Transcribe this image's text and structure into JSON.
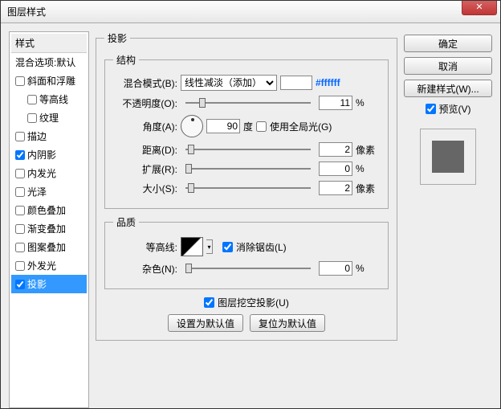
{
  "title": "图层样式",
  "left": {
    "header": "样式",
    "blend_defaults": "混合选项:默认",
    "items": [
      {
        "label": "斜面和浮雕",
        "checked": false,
        "sub": false
      },
      {
        "label": "等高线",
        "checked": false,
        "sub": true
      },
      {
        "label": "纹理",
        "checked": false,
        "sub": true
      },
      {
        "label": "描边",
        "checked": false,
        "sub": false
      },
      {
        "label": "内阴影",
        "checked": true,
        "sub": false
      },
      {
        "label": "内发光",
        "checked": false,
        "sub": false
      },
      {
        "label": "光泽",
        "checked": false,
        "sub": false
      },
      {
        "label": "颜色叠加",
        "checked": false,
        "sub": false
      },
      {
        "label": "渐变叠加",
        "checked": false,
        "sub": false
      },
      {
        "label": "图案叠加",
        "checked": false,
        "sub": false
      },
      {
        "label": "外发光",
        "checked": false,
        "sub": false
      },
      {
        "label": "投影",
        "checked": true,
        "sub": false,
        "selected": true
      }
    ]
  },
  "mid": {
    "group_title": "投影",
    "structure": "结构",
    "blend_mode_label": "混合模式(B):",
    "blend_mode_value": "线性减淡（添加）",
    "hex": "#ffffff",
    "opacity_label": "不透明度(O):",
    "opacity_value": "11",
    "percent": "%",
    "angle_label": "角度(A):",
    "angle_value": "90",
    "angle_unit": "度",
    "global_light": "使用全局光(G)",
    "distance_label": "距离(D):",
    "distance_value": "2",
    "px": "像素",
    "spread_label": "扩展(R):",
    "spread_value": "0",
    "size_label": "大小(S):",
    "size_value": "2",
    "quality": "品质",
    "contour_label": "等高线:",
    "antialias": "消除锯齿(L)",
    "noise_label": "杂色(N):",
    "noise_value": "0",
    "knockout": "图层挖空投影(U)",
    "make_default": "设置为默认值",
    "reset_default": "复位为默认值"
  },
  "right": {
    "ok": "确定",
    "cancel": "取消",
    "new_style": "新建样式(W)...",
    "preview": "预览(V)"
  }
}
